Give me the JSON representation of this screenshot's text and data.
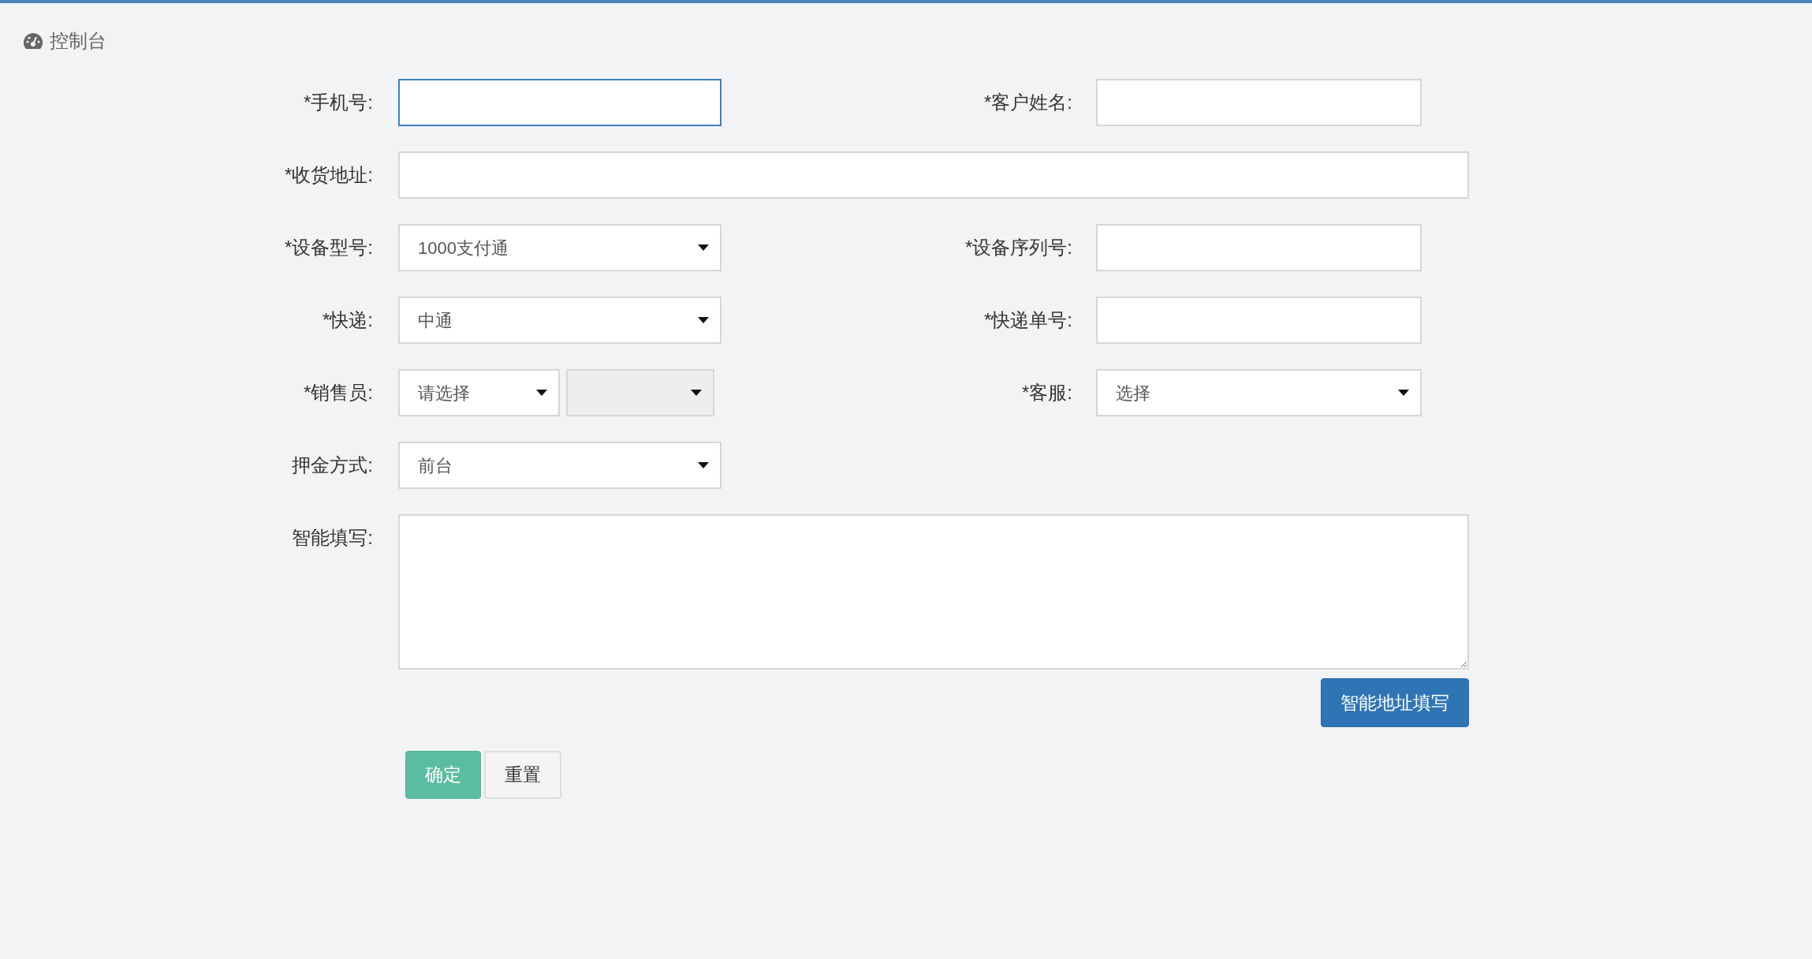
{
  "header": {
    "title": "控制台"
  },
  "rows": [
    {
      "fields": [
        {
          "kind": "text",
          "label": "*手机号:",
          "focused": true
        },
        {
          "kind": "text",
          "label": "*客户姓名:",
          "focused": false
        }
      ]
    },
    {
      "fields": [
        {
          "kind": "wide",
          "label": "*收货地址:",
          "focused": false
        }
      ]
    },
    {
      "fields": [
        {
          "kind": "select",
          "label": "*设备型号:",
          "selects": [
            {
              "value": "1000支付通",
              "disabled": false
            }
          ]
        },
        {
          "kind": "text",
          "label": "*设备序列号:",
          "focused": false
        }
      ]
    },
    {
      "fields": [
        {
          "kind": "select",
          "label": "*快递:",
          "selects": [
            {
              "value": "中通",
              "disabled": false
            }
          ]
        },
        {
          "kind": "text",
          "label": "*快递单号:",
          "focused": false
        }
      ]
    },
    {
      "fields": [
        {
          "kind": "select",
          "label": "*销售员:",
          "selects": [
            {
              "value": "请选择",
              "disabled": false
            },
            {
              "disabled": true
            }
          ]
        },
        {
          "kind": "select",
          "label": "*客服:",
          "selects": [
            {
              "value": "选择",
              "disabled": false
            }
          ]
        }
      ]
    },
    {
      "fields": [
        {
          "kind": "select",
          "label": "押金方式:",
          "selects": [
            {
              "value": "前台",
              "disabled": false
            }
          ]
        }
      ]
    },
    {
      "fields": [
        {
          "kind": "textarea",
          "label": "智能填写:",
          "focused": false
        }
      ]
    }
  ],
  "smart_fill_button": "智能地址填写",
  "actions": [
    {
      "label": "确定",
      "kind": "primary"
    },
    {
      "label": "重置",
      "kind": "secondary"
    }
  ]
}
